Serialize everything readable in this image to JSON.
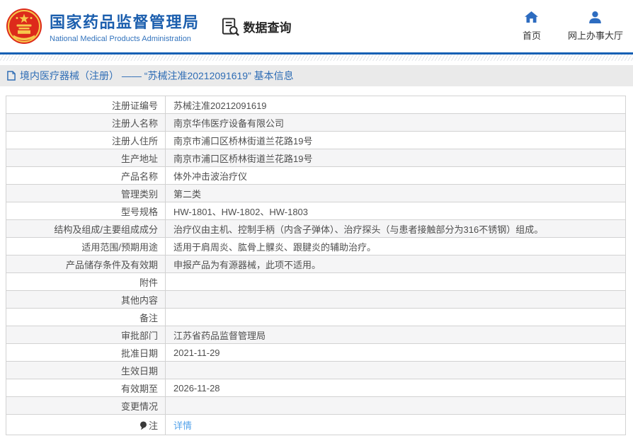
{
  "header": {
    "logo": {
      "icon": "national-emblem-icon",
      "title_cn": "国家药品监督管理局",
      "title_en": "National Medical Products Administration"
    },
    "search_section": {
      "icon": "document-search-icon",
      "label": "数据查询"
    },
    "nav": [
      {
        "icon": "home-icon",
        "label": "首页"
      },
      {
        "icon": "user-icon",
        "label": "网上办事大厅"
      }
    ]
  },
  "breadcrumb": {
    "icon": "document-icon",
    "text": "境内医疗器械（注册） —— “苏械注准20212091619” 基本信息"
  },
  "detail_table": {
    "rows": [
      {
        "label": "注册证编号",
        "value": "苏械注准20212091619"
      },
      {
        "label": "注册人名称",
        "value": "南京华伟医疗设备有限公司"
      },
      {
        "label": "注册人住所",
        "value": "南京市浦口区桥林街道兰花路19号"
      },
      {
        "label": "生产地址",
        "value": "南京市浦口区桥林街道兰花路19号"
      },
      {
        "label": "产品名称",
        "value": "体外冲击波治疗仪"
      },
      {
        "label": "管理类别",
        "value": "第二类"
      },
      {
        "label": "型号规格",
        "value": "HW-1801、HW-1802、HW-1803"
      },
      {
        "label": "结构及组成/主要组成成分",
        "value": "治疗仪由主机、控制手柄（内含子弹体）、治疗探头（与患者接触部分为316不锈钢）组成。"
      },
      {
        "label": "适用范围/预期用途",
        "value": "适用于肩周炎、肱骨上髁炎、跟腱炎的辅助治疗。"
      },
      {
        "label": "产品储存条件及有效期",
        "value": "申报产品为有源器械，此项不适用。"
      },
      {
        "label": "附件",
        "value": ""
      },
      {
        "label": "其他内容",
        "value": ""
      },
      {
        "label": "备注",
        "value": ""
      },
      {
        "label": "审批部门",
        "value": "江苏省药品监督管理局"
      },
      {
        "label": "批准日期",
        "value": "2021-11-29"
      },
      {
        "label": "生效日期",
        "value": ""
      },
      {
        "label": "有效期至",
        "value": "2026-11-28"
      },
      {
        "label": "变更情况",
        "value": ""
      },
      {
        "label": "注",
        "label_icon": "note-pin-icon",
        "value": "详情",
        "value_link": true
      }
    ]
  },
  "colors": {
    "brand_blue": "#1c5fae",
    "brand_blue_light": "#3474bd",
    "icon_blue": "#2d6cc0",
    "bar_blue": "#1660b4",
    "breadcrumb_bg": "#eaeaea",
    "breadcrumb_text": "#2f6db5",
    "row_alt_bg": "#f5f5f6",
    "table_border": "#d2d2d2",
    "link_blue": "#54a3ea",
    "emblem_red": "#dd2a1b",
    "emblem_gold": "#f7c84c"
  }
}
